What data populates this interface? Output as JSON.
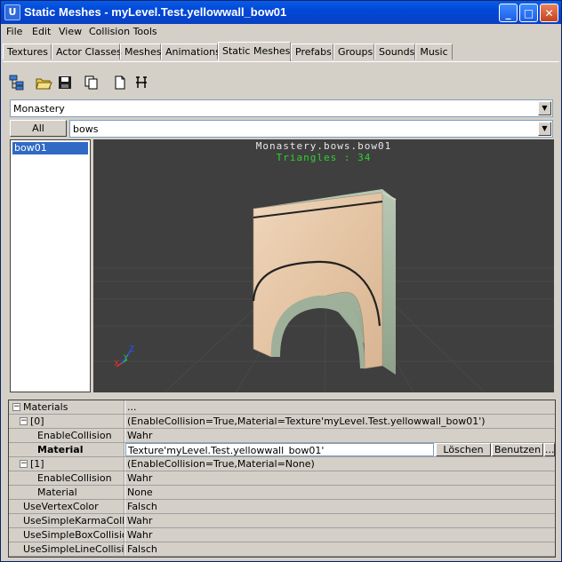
{
  "window": {
    "app_icon_letter": "U",
    "title": "Static Meshes - myLevel.Test.yellowwall_bow01"
  },
  "menu": [
    "File",
    "Edit",
    "View",
    "Collision Tools"
  ],
  "tabs": [
    "Textures",
    "Actor Classes",
    "Meshes",
    "Animations",
    "Static Meshes",
    "Prefabs",
    "Groups",
    "Sounds",
    "Music"
  ],
  "active_tab": "Static Meshes",
  "toolbar_icons": [
    "tree-view-icon",
    "open-folder-icon",
    "save-icon",
    "copy-icon",
    "new-document-icon",
    "tool-icon"
  ],
  "package_combo": {
    "value": "Monastery"
  },
  "group_filter": {
    "all_label": "All",
    "value": "bows"
  },
  "mesh_list": {
    "items": [
      "bow01"
    ],
    "selected": "bow01"
  },
  "viewport": {
    "mesh_name": "Monastery.bows.bow01",
    "triangles_text": "Triangles : 34",
    "axis_labels": {
      "x": "X",
      "y": "Y",
      "z": "Z"
    }
  },
  "properties": {
    "rows": [
      {
        "indent": 0,
        "expander": "−",
        "name": "Materials",
        "value": "...",
        "bold": false
      },
      {
        "indent": 1,
        "expander": "−",
        "name": "[0]",
        "value": "(EnableCollision=True,Material=Texture'myLevel.Test.yellowwall_bow01')",
        "bold": false
      },
      {
        "indent": 2,
        "expander": "",
        "name": "EnableCollision",
        "value": "Wahr",
        "bold": false
      },
      {
        "indent": 2,
        "expander": "",
        "name": "Material",
        "value": "Texture'myLevel.Test.yellowwall_bow01'",
        "bold": true,
        "editing": true
      },
      {
        "indent": 1,
        "expander": "−",
        "name": "[1]",
        "value": "(EnableCollision=True,Material=None)",
        "bold": false
      },
      {
        "indent": 2,
        "expander": "",
        "name": "EnableCollision",
        "value": "Wahr",
        "bold": false
      },
      {
        "indent": 2,
        "expander": "",
        "name": "Material",
        "value": "None",
        "bold": false
      },
      {
        "indent": 1,
        "expander": "",
        "name": "UseVertexColor",
        "value": "Falsch",
        "bold": false
      },
      {
        "indent": 1,
        "expander": "",
        "name": "UseSimpleKarmaColli...",
        "value": "Wahr",
        "bold": false
      },
      {
        "indent": 1,
        "expander": "",
        "name": "UseSimpleBoxCollision",
        "value": "Wahr",
        "bold": false
      },
      {
        "indent": 1,
        "expander": "",
        "name": "UseSimpleLineCollision",
        "value": "Falsch",
        "bold": false
      }
    ],
    "edit_buttons": {
      "clear": "Löschen",
      "use": "Benutzen",
      "browse": "..."
    }
  },
  "colors": {
    "titlebar": "#0a4fd8",
    "selection": "#316ac5",
    "viewport_bg": "#3f3f3f",
    "triangles_text": "#2fd12f",
    "mesh_name_text": "#e8e8e8"
  }
}
